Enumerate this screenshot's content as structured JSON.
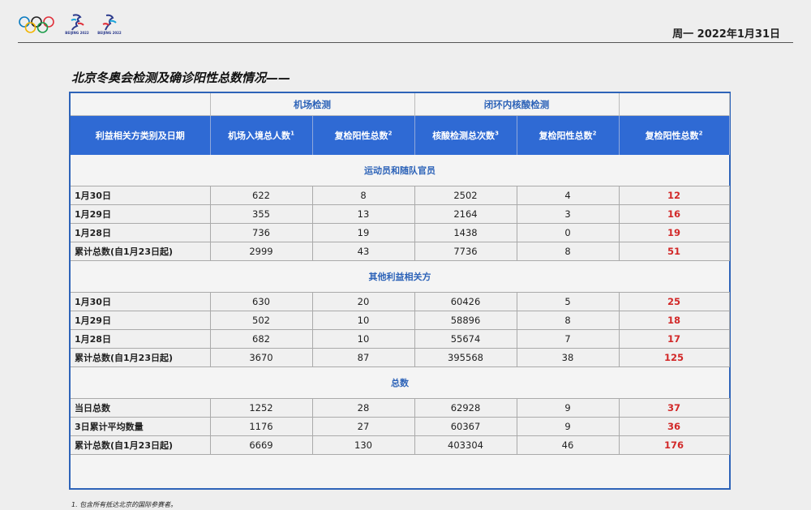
{
  "header": {
    "date": "周一 2022年1月31日",
    "heading": "北京冬奥会检测及确诊阳性总数情况——",
    "emblem_text": "BEIJING 2022"
  },
  "table": {
    "group_headers": [
      "",
      "机场检测",
      "闭环内核酸检测",
      ""
    ],
    "columns": [
      {
        "label": "利益相关方类别及日期",
        "sup": ""
      },
      {
        "label": "机场入境总人数",
        "sup": "1"
      },
      {
        "label": "复检阳性总数",
        "sup": "2"
      },
      {
        "label": "核酸检测总次数",
        "sup": "3"
      },
      {
        "label": "复检阳性总数",
        "sup": "2"
      },
      {
        "label": "复检阳性总数",
        "sup": "2"
      }
    ],
    "sections": [
      {
        "title": "运动员和随队官员",
        "rows": [
          [
            "1月30日",
            "622",
            "8",
            "2502",
            "4",
            "12"
          ],
          [
            "1月29日",
            "355",
            "13",
            "2164",
            "3",
            "16"
          ],
          [
            "1月28日",
            "736",
            "19",
            "1438",
            "0",
            "19"
          ],
          [
            "累计总数(自1月23日起)",
            "2999",
            "43",
            "7736",
            "8",
            "51"
          ]
        ]
      },
      {
        "title": "其他利益相关方",
        "rows": [
          [
            "1月30日",
            "630",
            "20",
            "60426",
            "5",
            "25"
          ],
          [
            "1月29日",
            "502",
            "10",
            "58896",
            "8",
            "18"
          ],
          [
            "1月28日",
            "682",
            "10",
            "55674",
            "7",
            "17"
          ],
          [
            "累计总数(自1月23日起)",
            "3670",
            "87",
            "395568",
            "38",
            "125"
          ]
        ]
      },
      {
        "title": "总数",
        "rows": [
          [
            "当日总数",
            "1252",
            "28",
            "62928",
            "9",
            "37"
          ],
          [
            "3日累计平均数量",
            "1176",
            "27",
            "60367",
            "9",
            "36"
          ],
          [
            "累计总数(自1月23日起)",
            "6669",
            "130",
            "403304",
            "46",
            "176"
          ]
        ]
      }
    ]
  },
  "footnote": "1. 包含所有抵达北京的国际参赛者。",
  "colors": {
    "accent": "#2f6ad4",
    "highlight": "#d22828"
  }
}
